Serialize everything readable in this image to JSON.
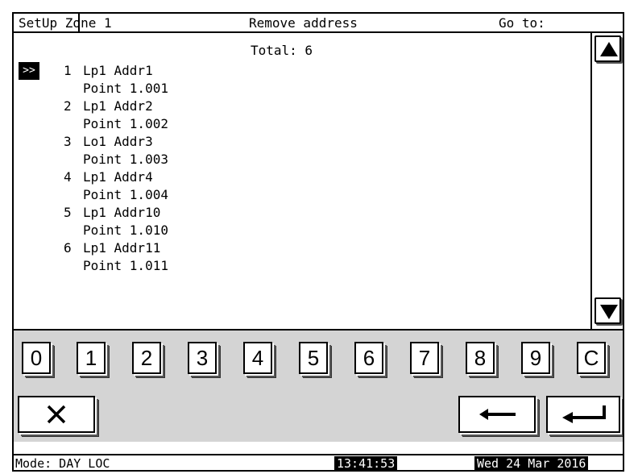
{
  "header": {
    "title": "SetUp Zone 1",
    "action": "Remove address",
    "goto": "Go to:"
  },
  "list": {
    "total_label": "Total: 6",
    "cursor": ">>",
    "items": [
      {
        "num": "1",
        "addr": "Lp1 Addr1",
        "point": "Point 1.001"
      },
      {
        "num": "2",
        "addr": "Lp1 Addr2",
        "point": "Point 1.002"
      },
      {
        "num": "3",
        "addr": "Lo1 Addr3",
        "point": "Point 1.003"
      },
      {
        "num": "4",
        "addr": "Lp1 Addr4",
        "point": "Point 1.004"
      },
      {
        "num": "5",
        "addr": "Lp1 Addr10",
        "point": "Point 1.010"
      },
      {
        "num": "6",
        "addr": "Lp1 Addr11",
        "point": "Point 1.011"
      }
    ]
  },
  "scrollbar": {
    "up_icon": "triangle-up-icon",
    "down_icon": "triangle-down-icon"
  },
  "keypad": {
    "keys": [
      "0",
      "1",
      "2",
      "3",
      "4",
      "5",
      "6",
      "7",
      "8",
      "9",
      "C"
    ],
    "cancel_icon": "close-x-icon",
    "backspace_icon": "arrow-left-icon",
    "enter_icon": "enter-return-icon"
  },
  "status": {
    "mode": "Mode: DAY LOC",
    "time": "13:41:53",
    "date": "Wed 24 Mar 2016"
  }
}
